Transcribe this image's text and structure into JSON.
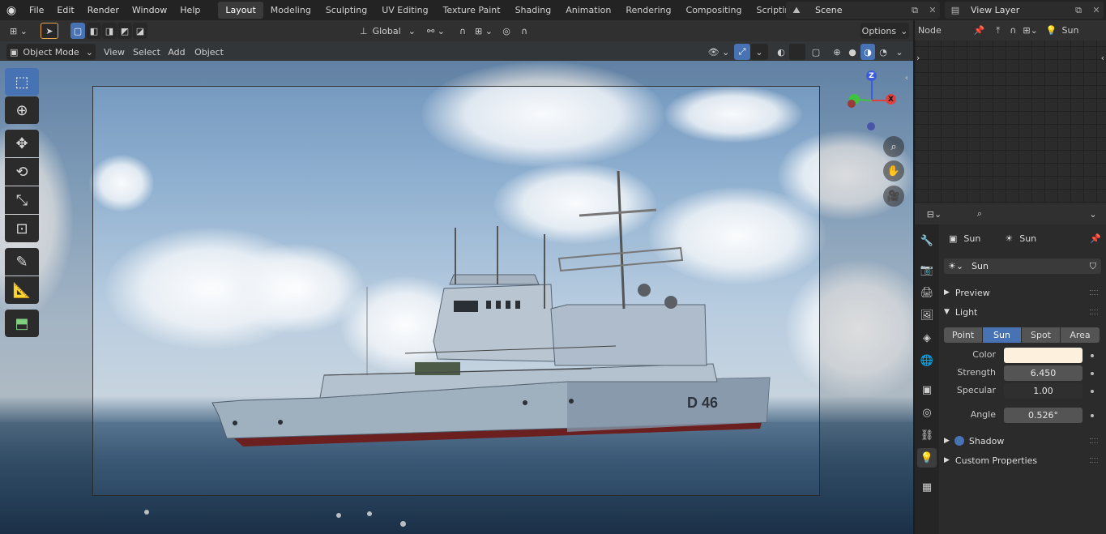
{
  "menu": {
    "items": [
      "File",
      "Edit",
      "Render",
      "Window",
      "Help"
    ]
  },
  "workspaces": {
    "tabs": [
      "Layout",
      "Modeling",
      "Sculpting",
      "UV Editing",
      "Texture Paint",
      "Shading",
      "Animation",
      "Rendering",
      "Compositing",
      "Scripting"
    ],
    "active_index": 0,
    "add_label": "+"
  },
  "scene": {
    "name": "Scene"
  },
  "view_layer": {
    "name": "View Layer"
  },
  "tool_header": {
    "transform_orientation": "Global",
    "options_label": "Options"
  },
  "view_header": {
    "mode": "Object Mode",
    "menus": [
      "View",
      "Select",
      "Add",
      "Object"
    ]
  },
  "viewport": {
    "hull_marking": "D 46",
    "gizmo_axes": {
      "z": "Z",
      "x": "X"
    }
  },
  "node_editor": {
    "header_label": "Node",
    "object_name": "Sun",
    "expand_glyph": "›"
  },
  "properties": {
    "breadcrumb_object": "Sun",
    "breadcrumb_data": "Sun",
    "datablock_name": "Sun",
    "panels": {
      "preview": "Preview",
      "light": "Light",
      "shadow": "Shadow",
      "custom": "Custom Properties"
    },
    "light_types": [
      "Point",
      "Sun",
      "Spot",
      "Area"
    ],
    "active_light_type": 1,
    "fields": {
      "color_label": "Color",
      "color_value": "#fdf0dd",
      "strength_label": "Strength",
      "strength_value": "6.450",
      "specular_label": "Specular",
      "specular_value": "1.00",
      "angle_label": "Angle",
      "angle_value": "0.526°"
    }
  },
  "colors": {
    "accent": "#4772b3",
    "header_bg": "#303030",
    "panel_bg": "#2b2b2b",
    "topbar_bg": "#232323",
    "axis_x": "#e04040",
    "axis_y": "#3fc43f",
    "axis_z": "#3d5dd8"
  }
}
